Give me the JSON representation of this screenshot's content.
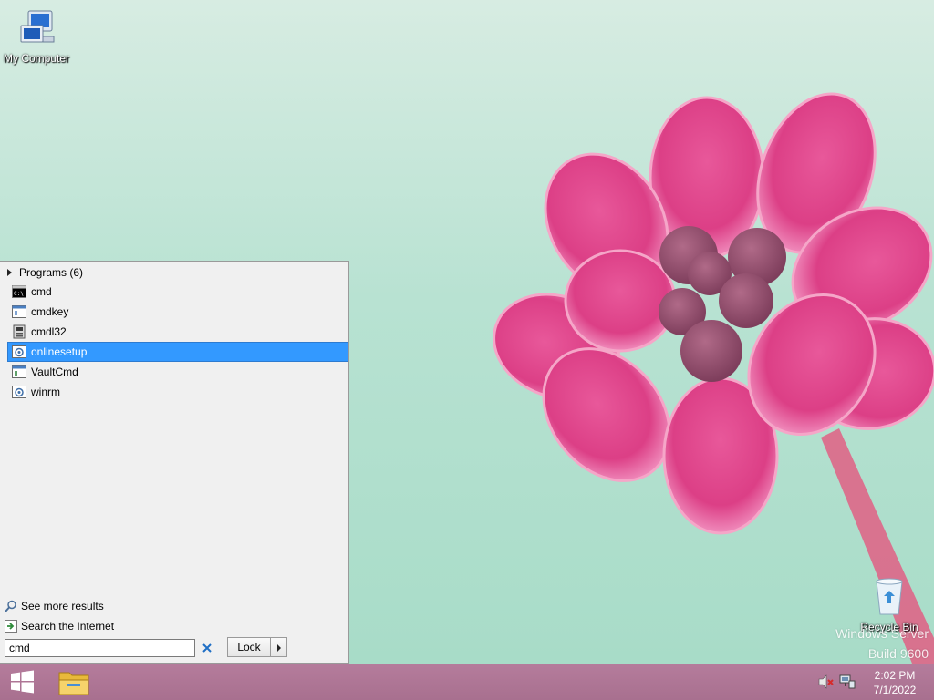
{
  "desktop": {
    "icons": [
      {
        "name": "my-computer",
        "label": "My Computer"
      },
      {
        "name": "recycle-bin",
        "label": "Recycle Bin"
      }
    ],
    "watermark": {
      "line1": "Windows Server",
      "line2": "Build 9600"
    }
  },
  "start_menu": {
    "programs_header": "Programs (6)",
    "results": [
      {
        "label": "cmd",
        "icon": "cmd-icon",
        "selected": false
      },
      {
        "label": "cmdkey",
        "icon": "console-app-icon",
        "selected": false
      },
      {
        "label": "cmdl32",
        "icon": "cmdl32-icon",
        "selected": false
      },
      {
        "label": "onlinesetup",
        "icon": "setup-gear-icon",
        "selected": true
      },
      {
        "label": "VaultCmd",
        "icon": "console-app-icon",
        "selected": false
      },
      {
        "label": "winrm",
        "icon": "setup-gear-icon",
        "selected": false
      }
    ],
    "see_more": "See more results",
    "search_internet": "Search the Internet",
    "search": {
      "value": "cmd"
    },
    "lock_label": "Lock"
  },
  "taskbar": {
    "clock_time": "2:02 PM",
    "clock_date": "7/1/2022"
  },
  "colors": {
    "selection": "#3399ff",
    "taskbar": "#a8708f",
    "menu_background": "#f0f0f0"
  }
}
